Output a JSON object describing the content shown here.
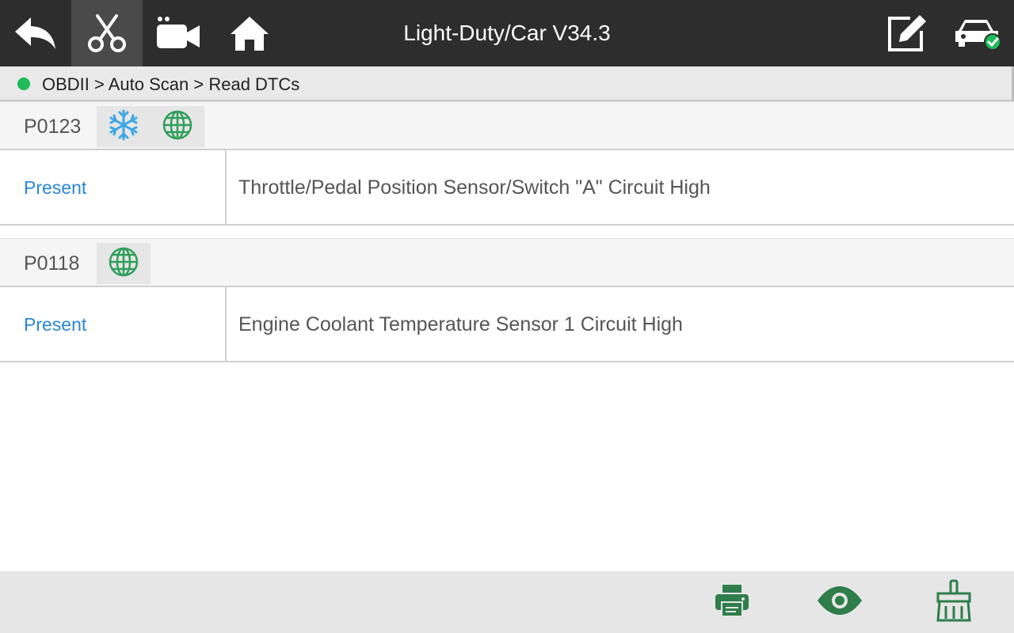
{
  "toolbar": {
    "title": "Light-Duty/Car V34.3",
    "buttons": [
      {
        "icon": "back-arrow-icon"
      },
      {
        "icon": "scissors-icon",
        "active": true
      },
      {
        "icon": "video-camera-icon"
      },
      {
        "icon": "home-icon"
      },
      {
        "icon": "edit-icon"
      },
      {
        "icon": "car-connected-icon"
      }
    ]
  },
  "breadcrumb": {
    "status_color": "#1dbb5a",
    "text": "OBDII > Auto Scan > Read DTCs"
  },
  "dtcs": [
    {
      "code": "P0123",
      "icons": [
        "snowflake-icon",
        "globe-icon"
      ],
      "status": "Present",
      "description": "Throttle/Pedal Position Sensor/Switch \"A\" Circuit High"
    },
    {
      "code": "P0118",
      "icons": [
        "globe-icon"
      ],
      "status": "Present",
      "description": "Engine Coolant Temperature Sensor 1 Circuit High"
    }
  ],
  "bottom_bar": {
    "accent": "#2e7d4a",
    "buttons": [
      {
        "icon": "print-icon"
      },
      {
        "icon": "eye-icon"
      },
      {
        "icon": "clear-broom-icon"
      }
    ]
  }
}
